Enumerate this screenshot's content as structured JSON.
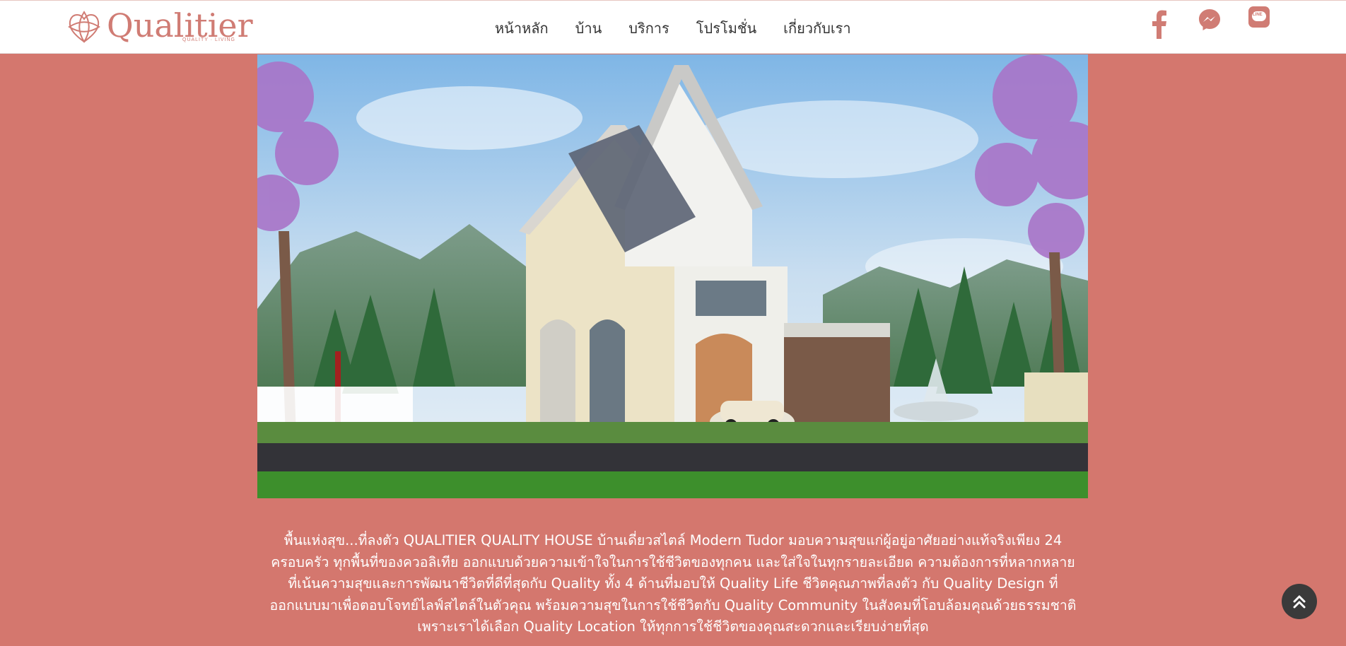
{
  "brand": {
    "name": "Qualitier",
    "tagline": "QUALITY · LIVING",
    "color": "#d07c74"
  },
  "nav": {
    "items": [
      {
        "label": "หน้าหลัก"
      },
      {
        "label": "บ้าน"
      },
      {
        "label": "บริการ"
      },
      {
        "label": "โปรโมชั่น"
      },
      {
        "label": "เกี่ยวกับเรา"
      }
    ]
  },
  "social": {
    "icons": [
      "facebook-icon",
      "messenger-icon",
      "line-icon"
    ],
    "line_text": "LINE"
  },
  "hero": {
    "description": "Illustrated Modern Tudor house with carport and parked car"
  },
  "caption": {
    "text": "พื้นแห่งสุข...ที่ลงตัว QUALITIER QUALITY HOUSE บ้านเดี่ยวสไตล์ Modern Tudor มอบความสุขแก่ผู้อยู่อาศัยอย่างแท้จริงเพียง 24 ครอบครัว ทุกพื้นที่ของควอลิเทีย ออกแบบด้วยความเข้าใจในการใช้ชีวิตของทุกคน และใส่ใจในทุกรายละเอียด ความต้องการที่หลากหลาย ที่เน้นความสุขและการพัฒนาชีวิตที่ดีที่สุดกับ Quality ทั้ง 4 ด้านที่มอบให้ Quality Life ชีวิตคุณภาพที่ลงตัว กับ Quality Design ที่ออกแบบมาเพื่อตอบโจทย์ไลฟ์สไตล์ในตัวคุณ พร้อมความสุขในการใช้ชีวิตกับ Quality Community ในสังคมที่โอบล้อมคุณด้วยธรรมชาติ เพราะเราได้เลือก Quality Location ให้ทุกการใช้ชีวิตของคุณสะดวกและเรียบง่ายที่สุด"
  },
  "colors": {
    "background": "#d4776e",
    "header": "#ffffff",
    "accent": "#d07c74",
    "back_to_top": "#3a3a3a"
  }
}
